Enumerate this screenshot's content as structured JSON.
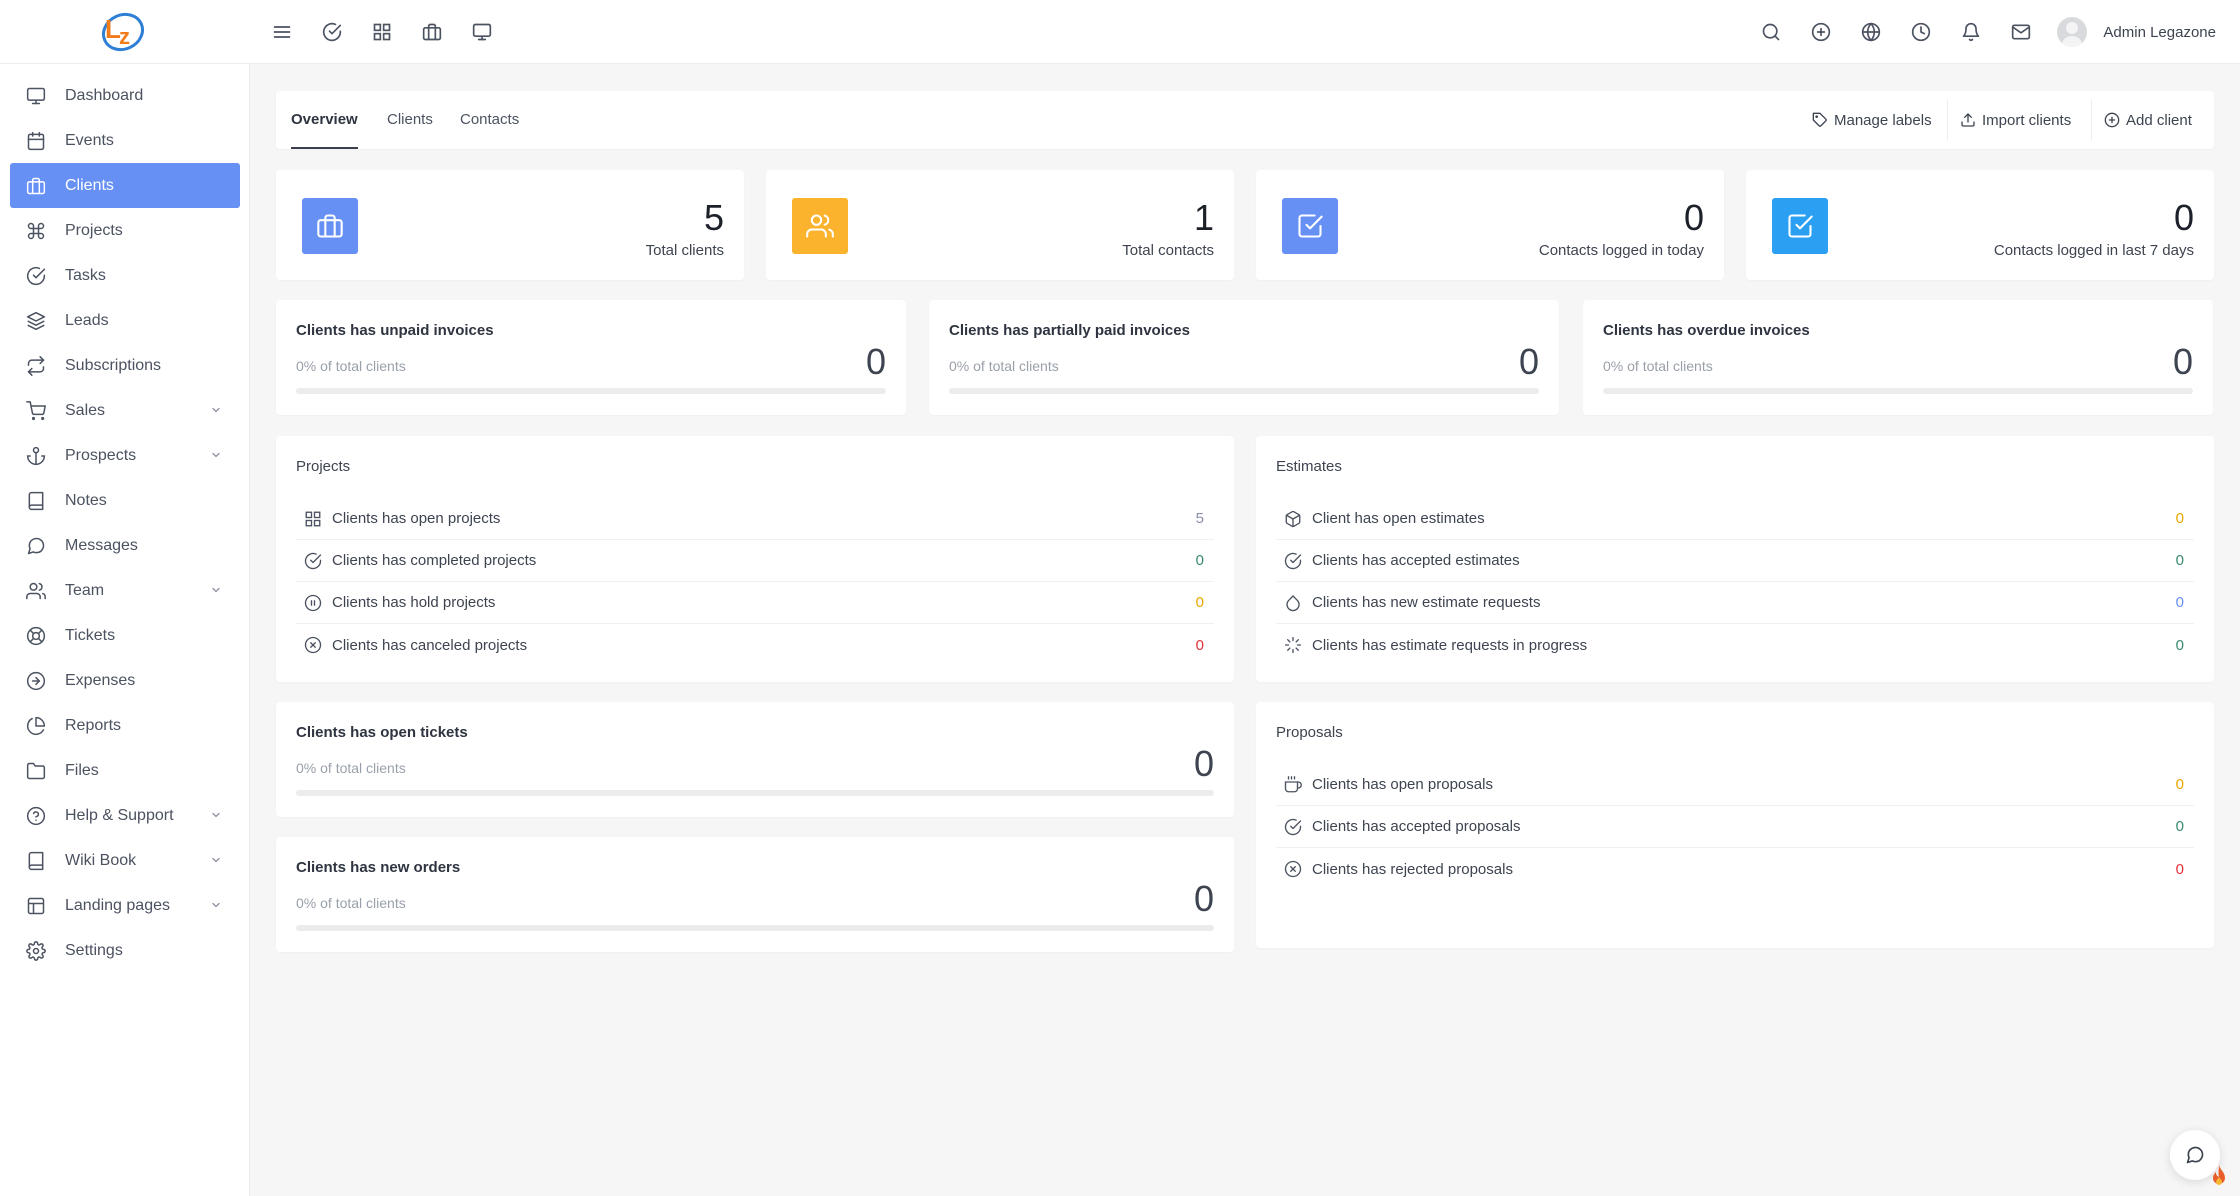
{
  "header": {
    "user_name": "Admin Legazone",
    "left_icons": [
      "menu-icon",
      "check-circle-icon",
      "grid-icon",
      "briefcase-icon",
      "monitor-icon"
    ],
    "right_icons": [
      "search-icon",
      "plus-circle-icon",
      "globe-icon",
      "clock-icon",
      "bell-icon",
      "mail-icon"
    ]
  },
  "sidebar": {
    "items": [
      {
        "label": "Dashboard",
        "icon": "monitor-icon",
        "active": false,
        "has_children": false
      },
      {
        "label": "Events",
        "icon": "calendar-icon",
        "active": false,
        "has_children": false
      },
      {
        "label": "Clients",
        "icon": "briefcase-icon",
        "active": true,
        "has_children": false
      },
      {
        "label": "Projects",
        "icon": "command-icon",
        "active": false,
        "has_children": false
      },
      {
        "label": "Tasks",
        "icon": "check-circle-icon",
        "active": false,
        "has_children": false
      },
      {
        "label": "Leads",
        "icon": "layers-icon",
        "active": false,
        "has_children": false
      },
      {
        "label": "Subscriptions",
        "icon": "repeat-icon",
        "active": false,
        "has_children": false
      },
      {
        "label": "Sales",
        "icon": "cart-icon",
        "active": false,
        "has_children": true
      },
      {
        "label": "Prospects",
        "icon": "anchor-icon",
        "active": false,
        "has_children": true
      },
      {
        "label": "Notes",
        "icon": "book-icon",
        "active": false,
        "has_children": false
      },
      {
        "label": "Messages",
        "icon": "message-circle-icon",
        "active": false,
        "has_children": false
      },
      {
        "label": "Team",
        "icon": "users-icon",
        "active": false,
        "has_children": true
      },
      {
        "label": "Tickets",
        "icon": "life-buoy-icon",
        "active": false,
        "has_children": false
      },
      {
        "label": "Expenses",
        "icon": "arrow-right-circle-icon",
        "active": false,
        "has_children": false
      },
      {
        "label": "Reports",
        "icon": "pie-chart-icon",
        "active": false,
        "has_children": false
      },
      {
        "label": "Files",
        "icon": "folder-icon",
        "active": false,
        "has_children": false
      },
      {
        "label": "Help & Support",
        "icon": "help-circle-icon",
        "active": false,
        "has_children": true
      },
      {
        "label": "Wiki Book",
        "icon": "book-icon",
        "active": false,
        "has_children": true
      },
      {
        "label": "Landing pages",
        "icon": "layout-icon",
        "active": false,
        "has_children": true
      },
      {
        "label": "Settings",
        "icon": "settings-icon",
        "active": false,
        "has_children": false
      }
    ]
  },
  "tabs": {
    "overview": "Overview",
    "clients": "Clients",
    "contacts": "Contacts",
    "manage_labels": "Manage labels",
    "import_clients": "Import clients",
    "add_client": "Add client"
  },
  "stats": [
    {
      "value": "5",
      "label": "Total clients",
      "icon": "briefcase-icon",
      "color": "#6690f4"
    },
    {
      "value": "1",
      "label": "Total contacts",
      "icon": "users-icon",
      "color": "#fbb32d"
    },
    {
      "value": "0",
      "label": "Contacts logged in today",
      "icon": "check-square-icon",
      "color": "#6690f4"
    },
    {
      "value": "0",
      "label": "Contacts logged in last 7 days",
      "icon": "check-square-icon",
      "color": "#2ba0f3"
    }
  ],
  "invoices": [
    {
      "title": "Clients has unpaid invoices",
      "sub": "0% of total clients",
      "value": "0",
      "progress": 0
    },
    {
      "title": "Clients has partially paid invoices",
      "sub": "0% of total clients",
      "value": "0",
      "progress": 0
    },
    {
      "title": "Clients has overdue invoices",
      "sub": "0% of total clients",
      "value": "0",
      "progress": 0
    }
  ],
  "projects": {
    "title": "Projects",
    "rows": [
      {
        "label": "Clients has open projects",
        "value": "5",
        "icon": "grid-icon",
        "color": "#8b8fa8"
      },
      {
        "label": "Clients has completed projects",
        "value": "0",
        "icon": "check-circle-icon",
        "color": "#3a8a6e"
      },
      {
        "label": "Clients has hold projects",
        "value": "0",
        "icon": "pause-circle-icon",
        "color": "#e9a800"
      },
      {
        "label": "Clients has canceled projects",
        "value": "0",
        "icon": "x-circle-icon",
        "color": "#e2323a"
      }
    ]
  },
  "estimates": {
    "title": "Estimates",
    "rows": [
      {
        "label": "Client has open estimates",
        "value": "0",
        "icon": "box-icon",
        "color": "#e9a800"
      },
      {
        "label": "Clients has accepted estimates",
        "value": "0",
        "icon": "check-circle-icon",
        "color": "#3a8a6e"
      },
      {
        "label": "Clients has new estimate requests",
        "value": "0",
        "icon": "droplet-icon",
        "color": "#6690f4"
      },
      {
        "label": "Clients has estimate requests in progress",
        "value": "0",
        "icon": "loader-icon",
        "color": "#3a8a6e"
      }
    ]
  },
  "tickets": {
    "title": "Clients has open tickets",
    "sub": "0% of total clients",
    "value": "0",
    "progress": 0
  },
  "orders": {
    "title": "Clients has new orders",
    "sub": "0% of total clients",
    "value": "0",
    "progress": 0
  },
  "proposals": {
    "title": "Proposals",
    "rows": [
      {
        "label": "Clients has open proposals",
        "value": "0",
        "icon": "coffee-icon",
        "color": "#e9a800"
      },
      {
        "label": "Clients has accepted proposals",
        "value": "0",
        "icon": "check-circle-icon",
        "color": "#3a8a6e"
      },
      {
        "label": "Clients has rejected proposals",
        "value": "0",
        "icon": "x-circle-icon",
        "color": "#e2323a"
      }
    ]
  }
}
